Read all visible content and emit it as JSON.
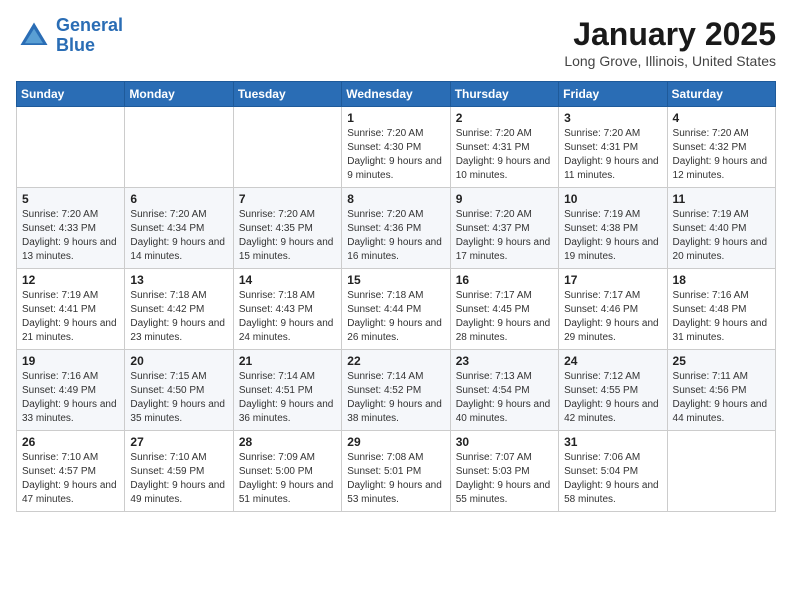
{
  "header": {
    "logo_line1": "General",
    "logo_line2": "Blue",
    "month": "January 2025",
    "location": "Long Grove, Illinois, United States"
  },
  "days_of_week": [
    "Sunday",
    "Monday",
    "Tuesday",
    "Wednesday",
    "Thursday",
    "Friday",
    "Saturday"
  ],
  "weeks": [
    [
      {
        "day": "",
        "info": ""
      },
      {
        "day": "",
        "info": ""
      },
      {
        "day": "",
        "info": ""
      },
      {
        "day": "1",
        "info": "Sunrise: 7:20 AM\nSunset: 4:30 PM\nDaylight: 9 hours and 9 minutes."
      },
      {
        "day": "2",
        "info": "Sunrise: 7:20 AM\nSunset: 4:31 PM\nDaylight: 9 hours and 10 minutes."
      },
      {
        "day": "3",
        "info": "Sunrise: 7:20 AM\nSunset: 4:31 PM\nDaylight: 9 hours and 11 minutes."
      },
      {
        "day": "4",
        "info": "Sunrise: 7:20 AM\nSunset: 4:32 PM\nDaylight: 9 hours and 12 minutes."
      }
    ],
    [
      {
        "day": "5",
        "info": "Sunrise: 7:20 AM\nSunset: 4:33 PM\nDaylight: 9 hours and 13 minutes."
      },
      {
        "day": "6",
        "info": "Sunrise: 7:20 AM\nSunset: 4:34 PM\nDaylight: 9 hours and 14 minutes."
      },
      {
        "day": "7",
        "info": "Sunrise: 7:20 AM\nSunset: 4:35 PM\nDaylight: 9 hours and 15 minutes."
      },
      {
        "day": "8",
        "info": "Sunrise: 7:20 AM\nSunset: 4:36 PM\nDaylight: 9 hours and 16 minutes."
      },
      {
        "day": "9",
        "info": "Sunrise: 7:20 AM\nSunset: 4:37 PM\nDaylight: 9 hours and 17 minutes."
      },
      {
        "day": "10",
        "info": "Sunrise: 7:19 AM\nSunset: 4:38 PM\nDaylight: 9 hours and 19 minutes."
      },
      {
        "day": "11",
        "info": "Sunrise: 7:19 AM\nSunset: 4:40 PM\nDaylight: 9 hours and 20 minutes."
      }
    ],
    [
      {
        "day": "12",
        "info": "Sunrise: 7:19 AM\nSunset: 4:41 PM\nDaylight: 9 hours and 21 minutes."
      },
      {
        "day": "13",
        "info": "Sunrise: 7:18 AM\nSunset: 4:42 PM\nDaylight: 9 hours and 23 minutes."
      },
      {
        "day": "14",
        "info": "Sunrise: 7:18 AM\nSunset: 4:43 PM\nDaylight: 9 hours and 24 minutes."
      },
      {
        "day": "15",
        "info": "Sunrise: 7:18 AM\nSunset: 4:44 PM\nDaylight: 9 hours and 26 minutes."
      },
      {
        "day": "16",
        "info": "Sunrise: 7:17 AM\nSunset: 4:45 PM\nDaylight: 9 hours and 28 minutes."
      },
      {
        "day": "17",
        "info": "Sunrise: 7:17 AM\nSunset: 4:46 PM\nDaylight: 9 hours and 29 minutes."
      },
      {
        "day": "18",
        "info": "Sunrise: 7:16 AM\nSunset: 4:48 PM\nDaylight: 9 hours and 31 minutes."
      }
    ],
    [
      {
        "day": "19",
        "info": "Sunrise: 7:16 AM\nSunset: 4:49 PM\nDaylight: 9 hours and 33 minutes."
      },
      {
        "day": "20",
        "info": "Sunrise: 7:15 AM\nSunset: 4:50 PM\nDaylight: 9 hours and 35 minutes."
      },
      {
        "day": "21",
        "info": "Sunrise: 7:14 AM\nSunset: 4:51 PM\nDaylight: 9 hours and 36 minutes."
      },
      {
        "day": "22",
        "info": "Sunrise: 7:14 AM\nSunset: 4:52 PM\nDaylight: 9 hours and 38 minutes."
      },
      {
        "day": "23",
        "info": "Sunrise: 7:13 AM\nSunset: 4:54 PM\nDaylight: 9 hours and 40 minutes."
      },
      {
        "day": "24",
        "info": "Sunrise: 7:12 AM\nSunset: 4:55 PM\nDaylight: 9 hours and 42 minutes."
      },
      {
        "day": "25",
        "info": "Sunrise: 7:11 AM\nSunset: 4:56 PM\nDaylight: 9 hours and 44 minutes."
      }
    ],
    [
      {
        "day": "26",
        "info": "Sunrise: 7:10 AM\nSunset: 4:57 PM\nDaylight: 9 hours and 47 minutes."
      },
      {
        "day": "27",
        "info": "Sunrise: 7:10 AM\nSunset: 4:59 PM\nDaylight: 9 hours and 49 minutes."
      },
      {
        "day": "28",
        "info": "Sunrise: 7:09 AM\nSunset: 5:00 PM\nDaylight: 9 hours and 51 minutes."
      },
      {
        "day": "29",
        "info": "Sunrise: 7:08 AM\nSunset: 5:01 PM\nDaylight: 9 hours and 53 minutes."
      },
      {
        "day": "30",
        "info": "Sunrise: 7:07 AM\nSunset: 5:03 PM\nDaylight: 9 hours and 55 minutes."
      },
      {
        "day": "31",
        "info": "Sunrise: 7:06 AM\nSunset: 5:04 PM\nDaylight: 9 hours and 58 minutes."
      },
      {
        "day": "",
        "info": ""
      }
    ]
  ]
}
